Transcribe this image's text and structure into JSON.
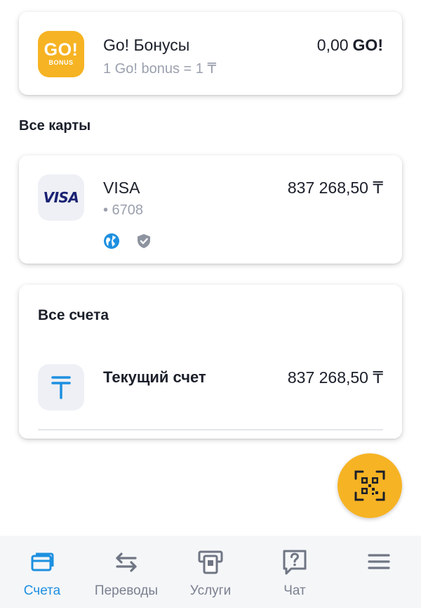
{
  "bonus": {
    "logo_top": "GO!",
    "logo_bottom": "BONUS",
    "title": "Go! Бонусы",
    "rate": "1 Go! bonus = 1 ₸",
    "amount": "0,00",
    "currency": "GO!",
    "logo_color": "#f6b323"
  },
  "cards_section": {
    "title": "Все карты"
  },
  "visa_card": {
    "logo": "VISA",
    "name": "VISA",
    "number": "• 6708",
    "amount": "837 268,50 ₸",
    "icons": [
      "globe-icon",
      "shield-check-icon"
    ]
  },
  "accounts": {
    "title": "Все счета",
    "items": [
      {
        "icon": "tenge-icon",
        "name": "Текущий счет",
        "amount": "837 268,50 ₸"
      }
    ]
  },
  "qr_button": {
    "icon": "qr-scan-icon",
    "color": "#f6b323"
  },
  "nav": {
    "active_color": "#1d90e0",
    "items": [
      {
        "label": "Счета",
        "icon": "cards-icon",
        "active": true
      },
      {
        "label": "Переводы",
        "icon": "transfer-arrows-icon",
        "active": false
      },
      {
        "label": "Услуги",
        "icon": "payment-terminal-icon",
        "active": false
      },
      {
        "label": "Чат",
        "icon": "chat-question-icon",
        "active": false
      },
      {
        "label": "",
        "icon": "menu-icon",
        "active": false
      }
    ]
  }
}
